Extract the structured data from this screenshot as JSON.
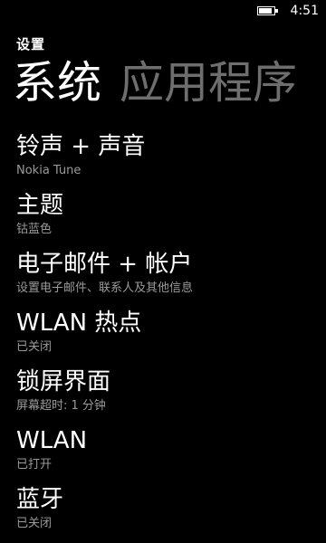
{
  "status_bar": {
    "time": "4:51",
    "battery_level": 0.85
  },
  "header": {
    "app_title": "设置",
    "pivots": [
      {
        "label": "系统",
        "active": true
      },
      {
        "label": "应用程序",
        "active": false
      }
    ]
  },
  "settings": [
    {
      "title": "铃声 + 声音",
      "subtitle": "Nokia Tune"
    },
    {
      "title": "主题",
      "subtitle": "钴蓝色"
    },
    {
      "title": "电子邮件 + 帐户",
      "subtitle": "设置电子邮件、联系人及其他信息"
    },
    {
      "title": "WLAN 热点",
      "subtitle": "已关闭"
    },
    {
      "title": "锁屏界面",
      "subtitle": "屏幕超时: 1 分钟"
    },
    {
      "title": "WLAN",
      "subtitle": "已打开"
    },
    {
      "title": "蓝牙",
      "subtitle": "已关闭"
    }
  ],
  "colors": {
    "background": "#000000",
    "text": "#ffffff",
    "subtitle": "#9a9a9a",
    "inactive_pivot": "#6e6e6e"
  }
}
